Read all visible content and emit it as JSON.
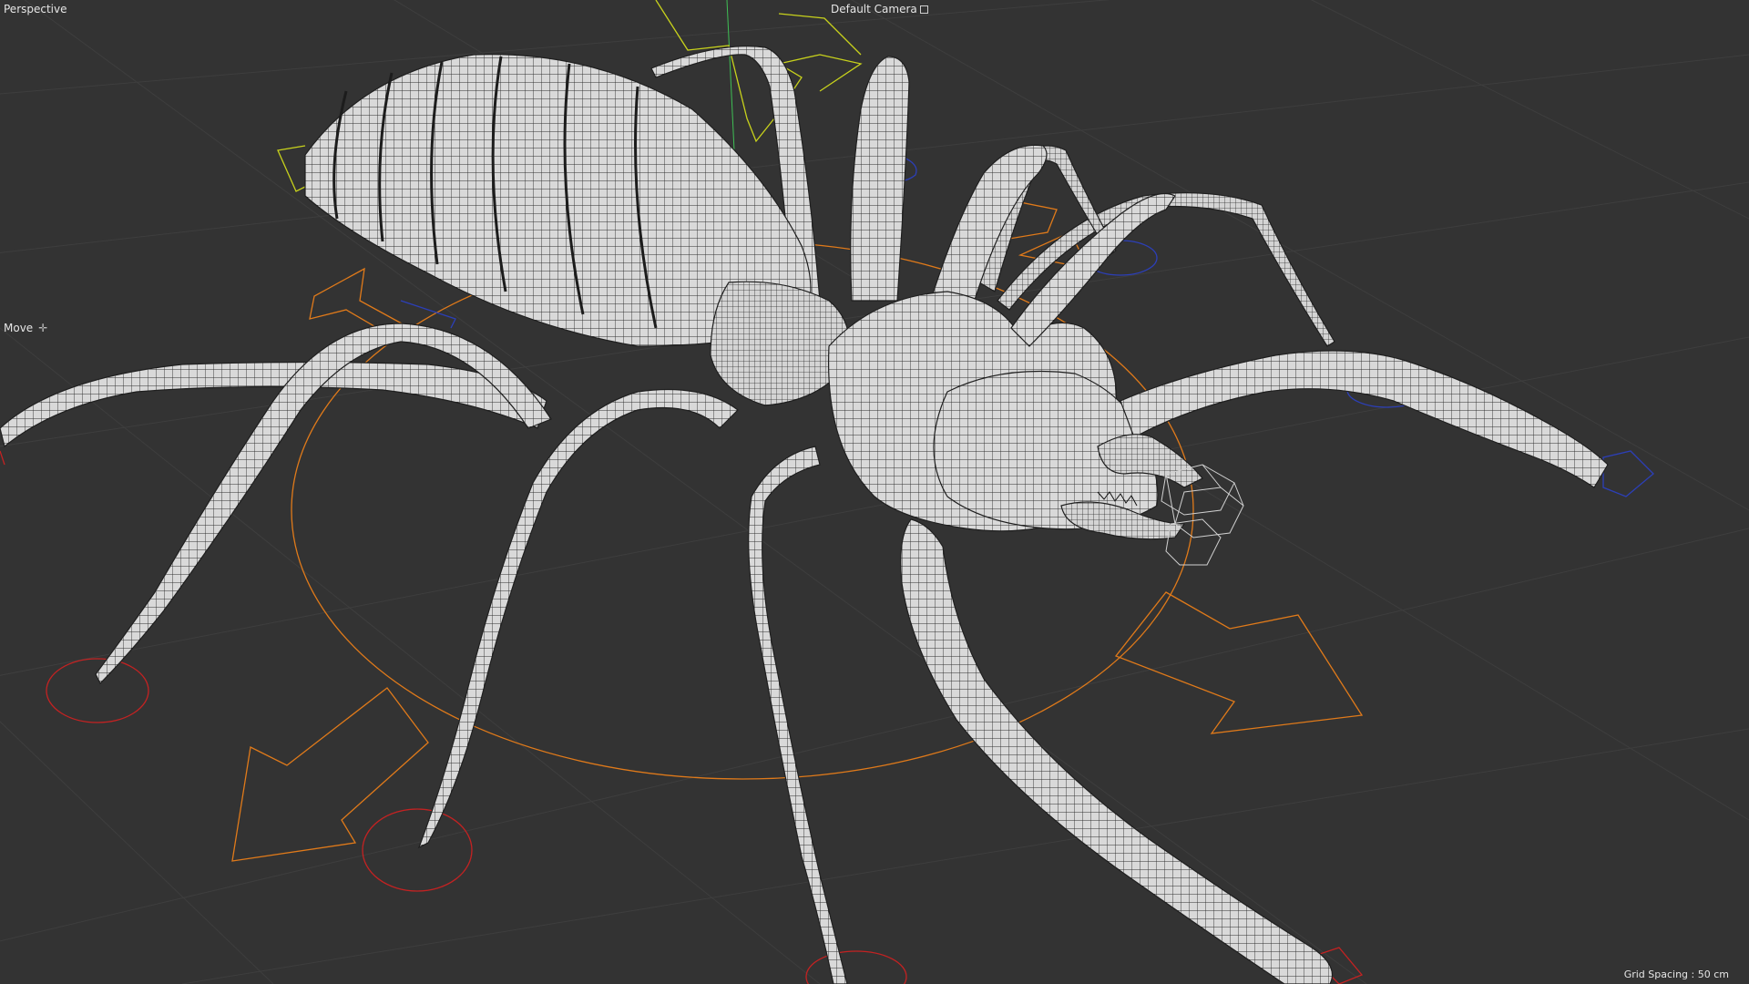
{
  "viewport": {
    "view_name": "Perspective",
    "camera_name": "Default Camera",
    "camera_icon": "camera-square-icon",
    "tool_name": "Move",
    "tool_icon": "move-cross-icon",
    "grid_spacing": "Grid Spacing : 50 cm"
  },
  "scene": {
    "object": "spider wireframe mesh",
    "colors": {
      "background": "#333333",
      "grid": "#3d3d3d",
      "mesh_fill": "#d8d8d8",
      "mesh_wire": "#2a2a2a",
      "orange_handle": "#e07a1a",
      "red_handle": "#c42222",
      "blue_handle": "#2c3fb8",
      "yellow_handle": "#c8d21c",
      "green_axis": "#3fbf55"
    }
  }
}
